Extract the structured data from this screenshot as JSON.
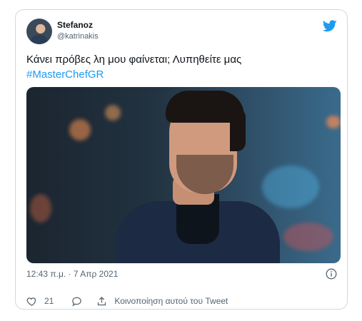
{
  "tweet": {
    "user": {
      "display_name": "Stefanoz",
      "handle": "@katrinakis"
    },
    "text": "Κάνει πρόβες λη μου φαίνεται; Λυπηθείτε μας",
    "hashtag": "#MasterChefGR",
    "timestamp": "12:43 π.μ. · 7 Απρ 2021",
    "likes_count": "21",
    "share_label": "Κοινοποίηση αυτού του Tweet"
  },
  "colors": {
    "accent": "#1d9bf0",
    "secondary_text": "#536471"
  },
  "icons": {
    "brand": "twitter-bird-icon",
    "info": "info-icon",
    "like": "heart-icon",
    "reply": "reply-bubble-icon",
    "share": "share-upload-icon"
  }
}
